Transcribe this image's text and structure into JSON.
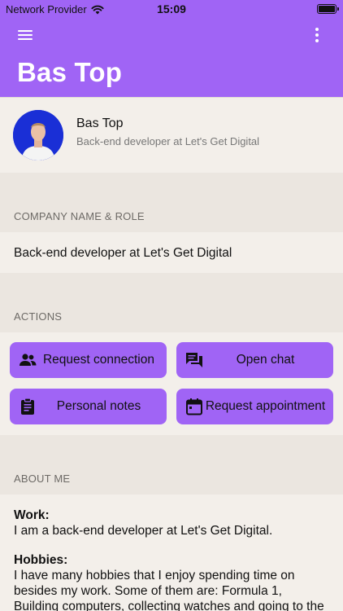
{
  "status_bar": {
    "carrier": "Network Provider",
    "time": "15:09"
  },
  "header": {
    "title": "Bas Top"
  },
  "profile": {
    "name": "Bas Top",
    "role": "Back-end developer at Let's Get Digital"
  },
  "company": {
    "section_label": "COMPANY NAME & ROLE",
    "value": "Back-end developer at Let's Get Digital"
  },
  "actions": {
    "section_label": "ACTIONS",
    "buttons": [
      {
        "label": "Request connection",
        "icon": "people-icon"
      },
      {
        "label": "Open chat",
        "icon": "chat-icon"
      },
      {
        "label": "Personal notes",
        "icon": "clipboard-icon"
      },
      {
        "label": "Request appointment",
        "icon": "calendar-icon"
      }
    ]
  },
  "about": {
    "section_label": "ABOUT ME",
    "work_heading": "Work:",
    "work_text": "I am a back-end developer at Let's Get Digital.",
    "hobbies_heading": "Hobbies:",
    "hobbies_text": "I have many hobbies that I enjoy spending time on besides my work. Some of them are: Formula 1, Building computers, collecting watches and going to the movies."
  },
  "colors": {
    "accent": "#a064f5",
    "background": "#efebe6",
    "card": "#f3efea"
  }
}
